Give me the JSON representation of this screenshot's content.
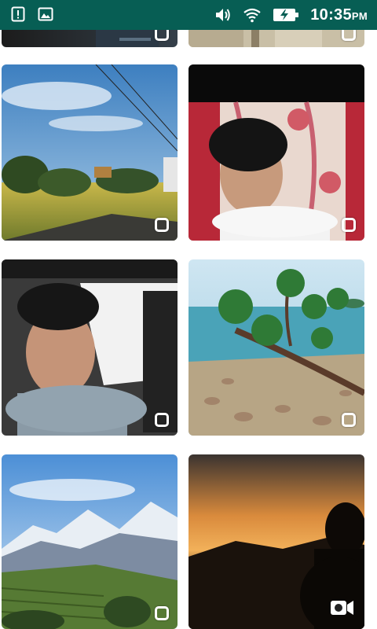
{
  "status_bar": {
    "time": "10:35",
    "ampm": "PM",
    "icons": [
      "notification-alert-icon",
      "image-icon",
      "volume-icon",
      "wifi-icon",
      "battery-charging-icon"
    ],
    "background": "#075e54"
  },
  "gallery": {
    "items": [
      {
        "kind": "photo",
        "scene": "dark-partial"
      },
      {
        "kind": "photo",
        "scene": "sand-partial"
      },
      {
        "kind": "photo",
        "scene": "rural-landscape"
      },
      {
        "kind": "photo",
        "scene": "boy-portrait-curtain"
      },
      {
        "kind": "photo",
        "scene": "boy-selfie-car"
      },
      {
        "kind": "photo",
        "scene": "tree-on-beach"
      },
      {
        "kind": "photo",
        "scene": "mountain-valley"
      },
      {
        "kind": "video",
        "scene": "sunset-silhouette"
      }
    ]
  }
}
